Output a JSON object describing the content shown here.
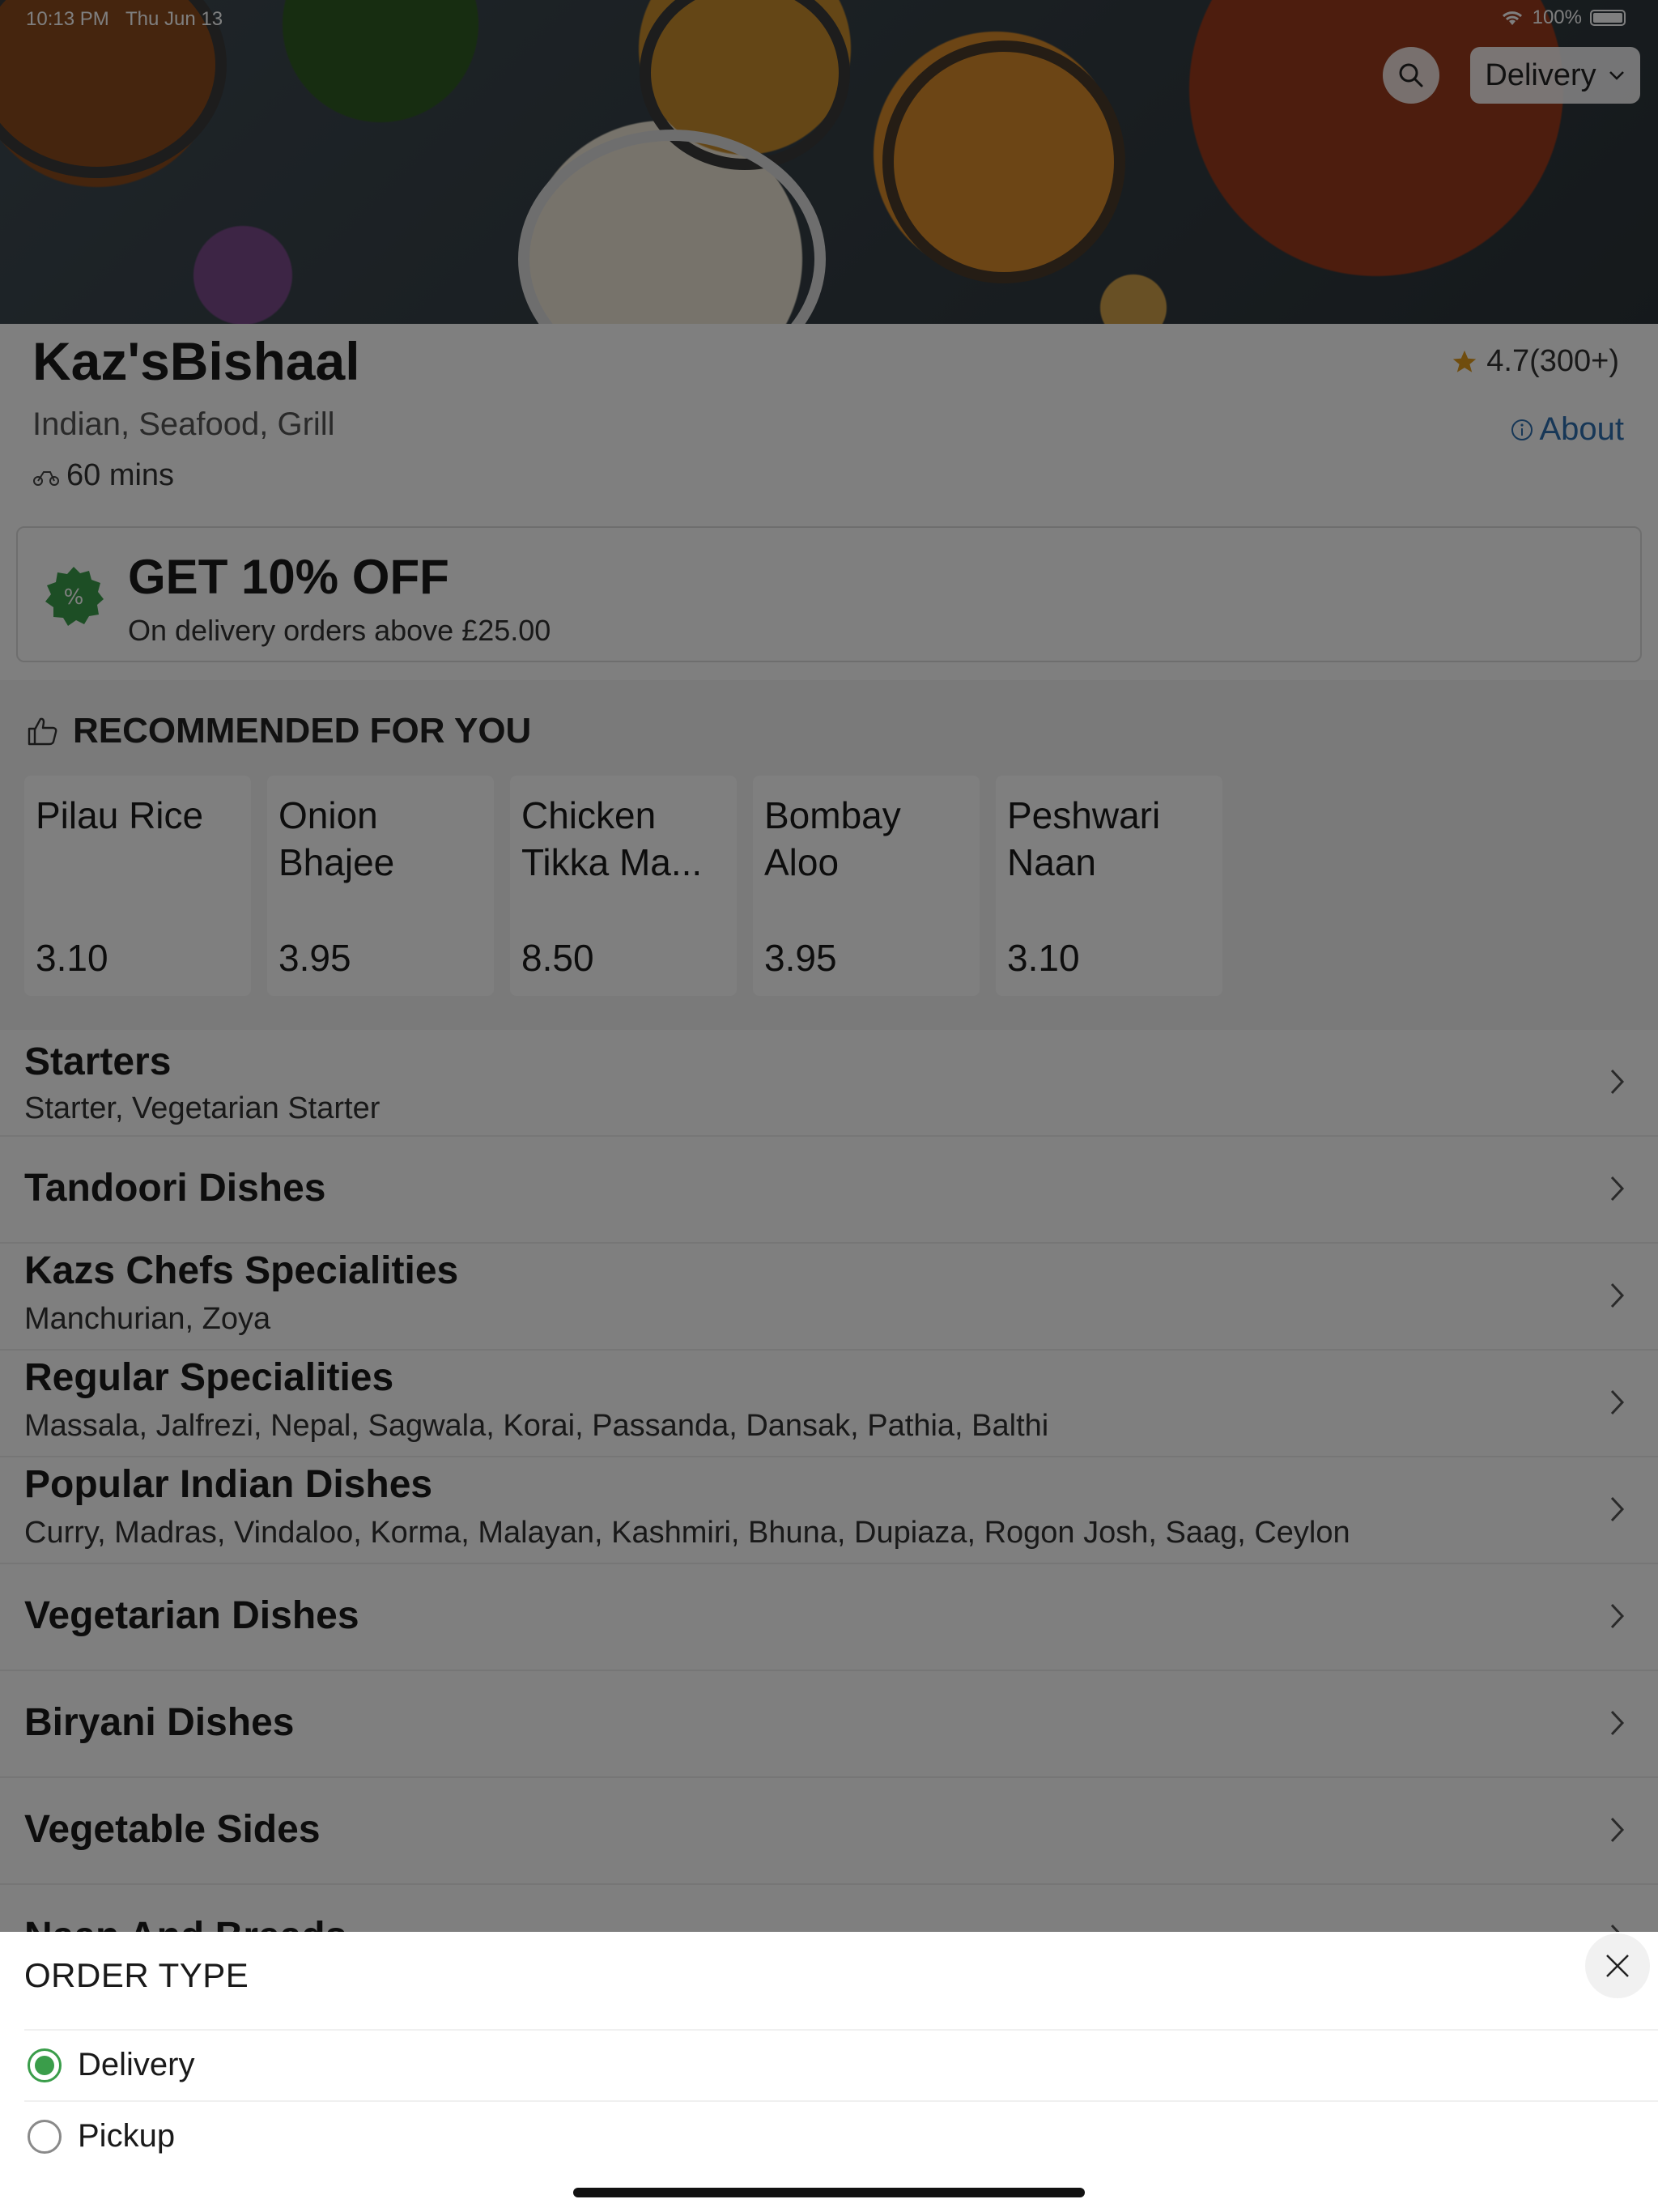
{
  "status_bar": {
    "time": "10:13 PM",
    "date": "Thu Jun 13",
    "battery": "100%"
  },
  "hero": {
    "order_type_label": "Delivery"
  },
  "restaurant": {
    "name": "Kaz'sBishaal",
    "cuisine": "Indian, Seafood, Grill",
    "delivery_time": "60 mins",
    "rating": "4.7(300+)",
    "about_label": "About"
  },
  "offer": {
    "title": "GET 10% OFF",
    "subtitle": "On delivery orders above £25.00",
    "badge_symbol": "%"
  },
  "recommended": {
    "heading": "RECOMMENDED FOR YOU",
    "items": [
      {
        "name": "Pilau Rice",
        "price": "3.10"
      },
      {
        "name": "Onion Bhajee",
        "price": "3.95"
      },
      {
        "name": "Chicken Tikka Ma...",
        "price": "8.50"
      },
      {
        "name": "Bombay Aloo",
        "price": "3.95"
      },
      {
        "name": "Peshwari Naan",
        "price": "3.10"
      }
    ]
  },
  "categories": [
    {
      "title": "Starters",
      "subtitle": "Starter, Vegetarian Starter"
    },
    {
      "title": "Tandoori Dishes",
      "subtitle": ""
    },
    {
      "title": "Kazs Chefs Specialities",
      "subtitle": "Manchurian, Zoya"
    },
    {
      "title": "Regular Specialities",
      "subtitle": "Massala, Jalfrezi, Nepal, Sagwala, Korai, Passanda, Dansak, Pathia, Balthi"
    },
    {
      "title": "Popular Indian Dishes",
      "subtitle": "Curry, Madras, Vindaloo, Korma, Malayan, Kashmiri, Bhuna, Dupiaza, Rogon Josh, Saag, Ceylon"
    },
    {
      "title": "Vegetarian Dishes",
      "subtitle": ""
    },
    {
      "title": "Biryani Dishes",
      "subtitle": ""
    },
    {
      "title": "Vegetable Sides",
      "subtitle": ""
    },
    {
      "title": "Naan And Breads",
      "subtitle": ""
    }
  ],
  "order_sheet": {
    "title": "ORDER TYPE",
    "options": [
      {
        "label": "Delivery",
        "selected": true
      },
      {
        "label": "Pickup",
        "selected": false
      }
    ]
  },
  "colors": {
    "accent_green": "#3a9d4a",
    "link_blue": "#2f6fae",
    "star": "#e09a1c"
  }
}
